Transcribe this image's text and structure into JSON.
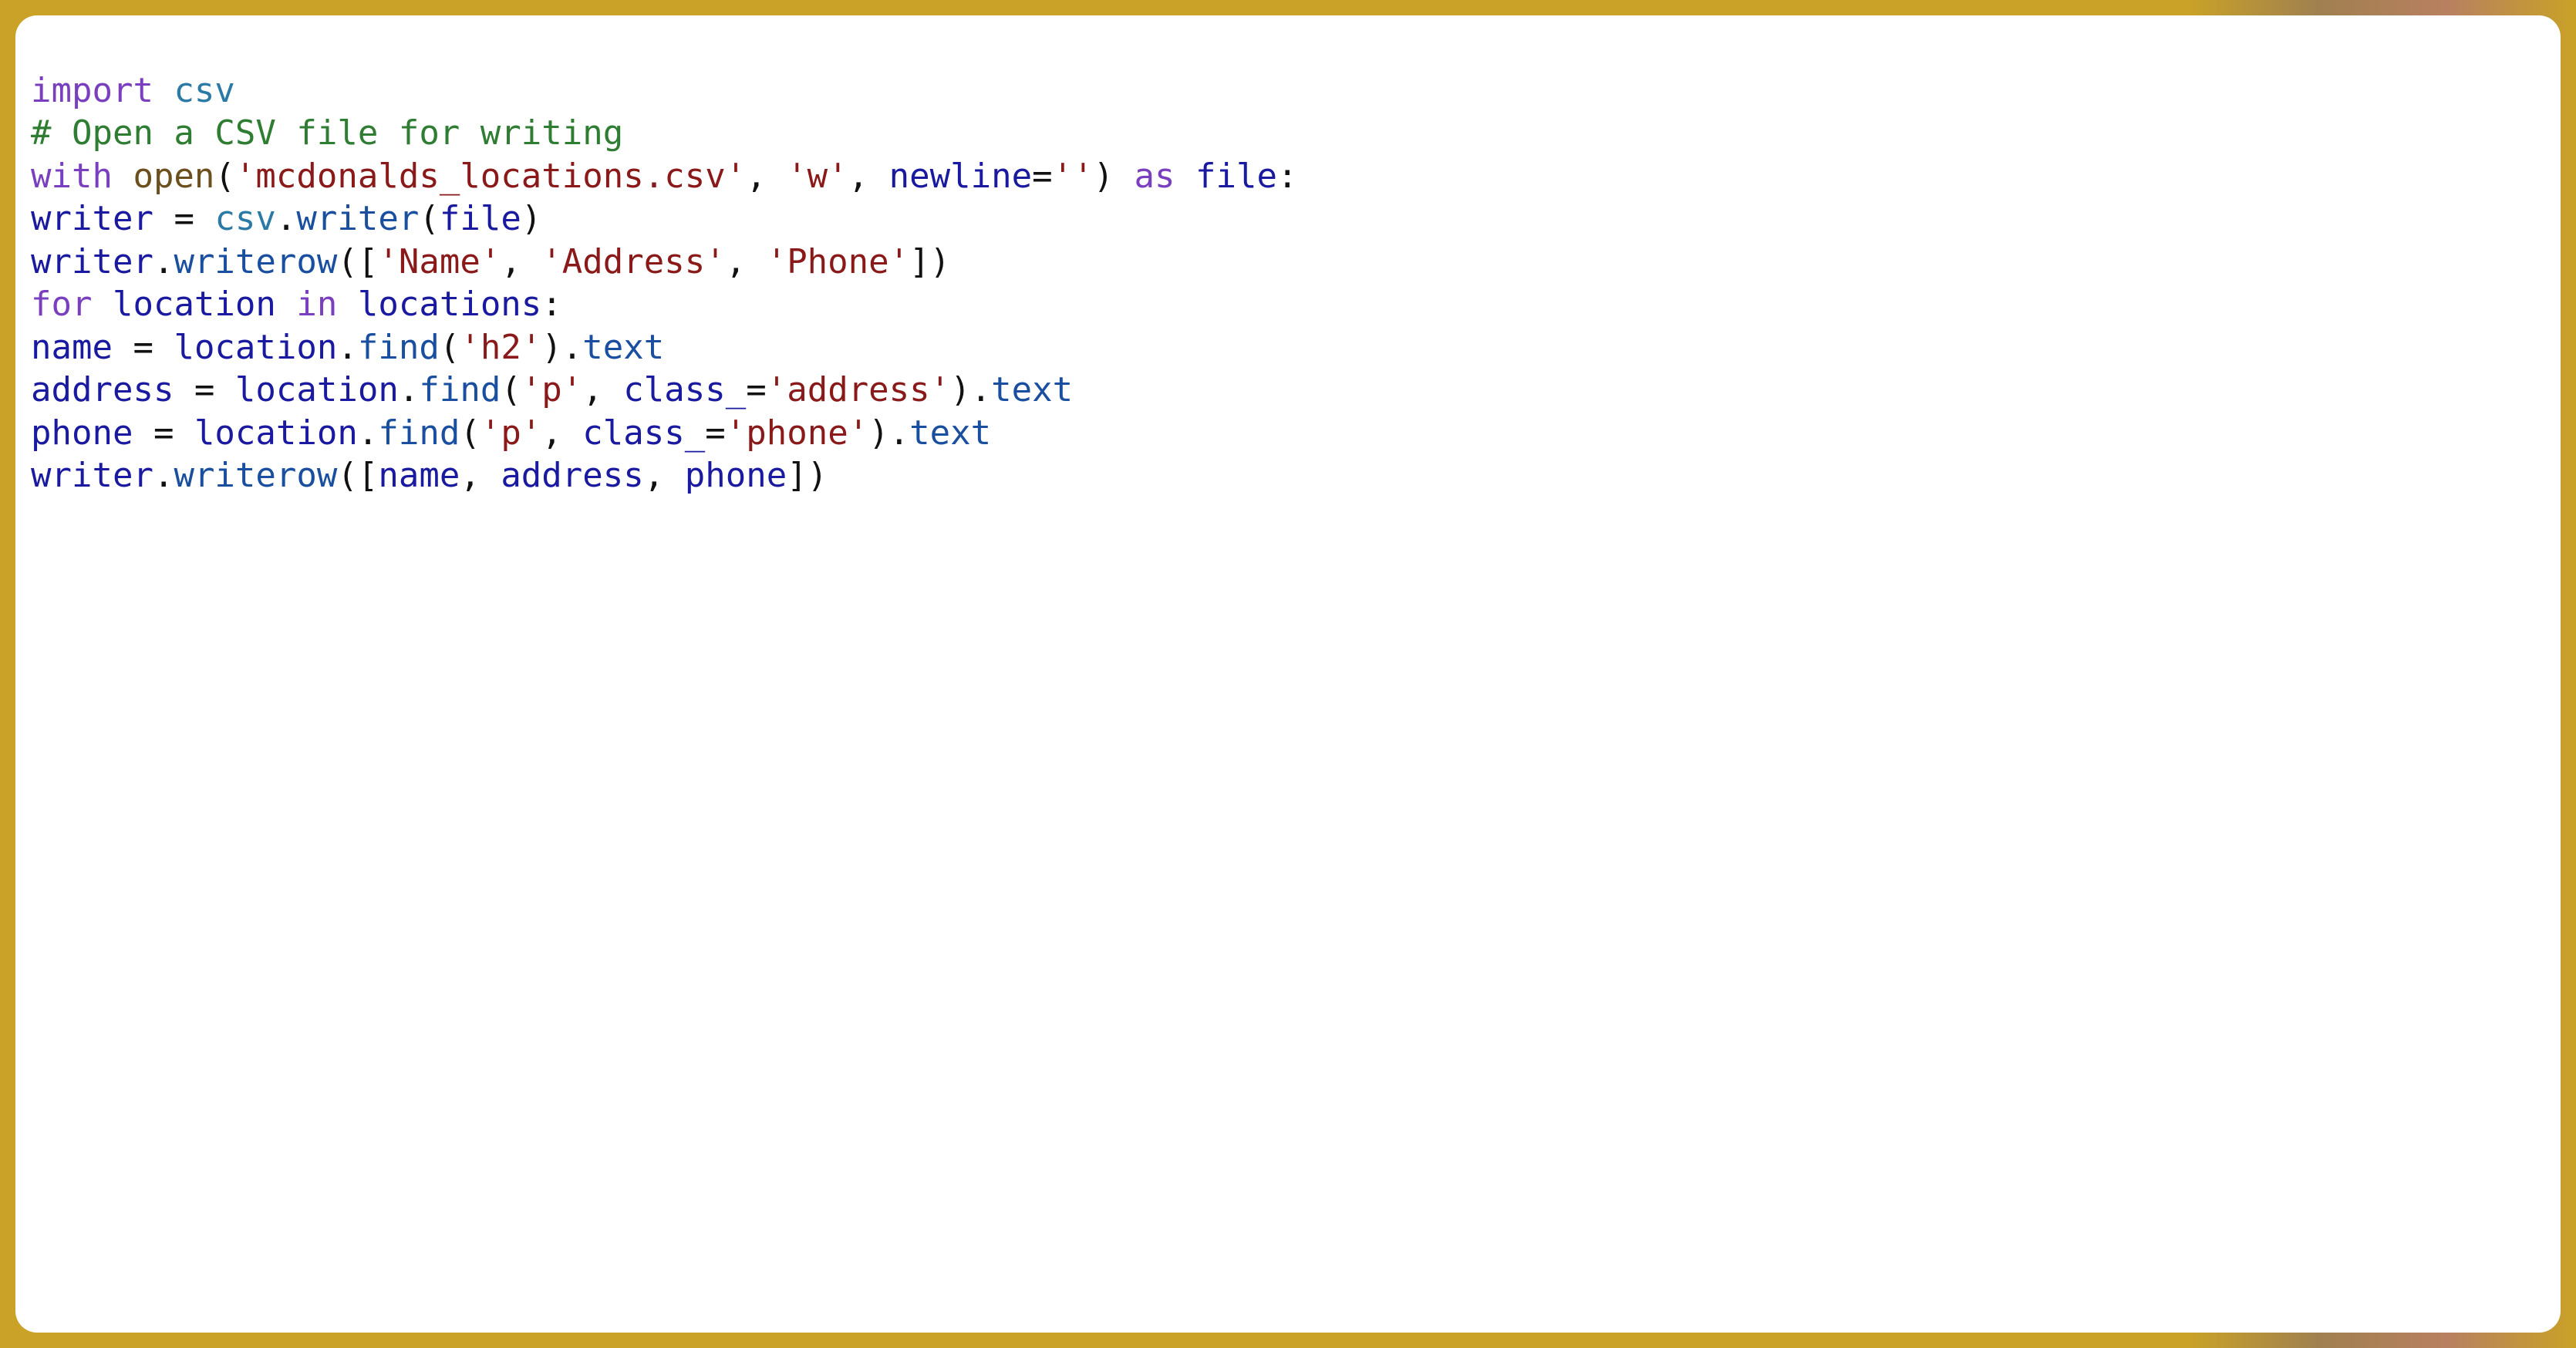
{
  "code": {
    "lines": [
      {
        "tokens": [
          {
            "t": "import ",
            "c": "tok-keyword"
          },
          {
            "t": "csv",
            "c": "tok-module"
          }
        ]
      },
      {
        "tokens": [
          {
            "t": "# Open a CSV file for writing",
            "c": "tok-comment"
          }
        ]
      },
      {
        "tokens": [
          {
            "t": "with ",
            "c": "tok-keyword"
          },
          {
            "t": "open",
            "c": "tok-builtin"
          },
          {
            "t": "(",
            "c": "tok-punct"
          },
          {
            "t": "'mcdonalds_locations.csv'",
            "c": "tok-string"
          },
          {
            "t": ", ",
            "c": "tok-punct"
          },
          {
            "t": "'w'",
            "c": "tok-string"
          },
          {
            "t": ", ",
            "c": "tok-punct"
          },
          {
            "t": "newline",
            "c": "tok-param"
          },
          {
            "t": "=",
            "c": "tok-punct"
          },
          {
            "t": "''",
            "c": "tok-string"
          },
          {
            "t": ") ",
            "c": "tok-punct"
          },
          {
            "t": "as ",
            "c": "tok-keyword"
          },
          {
            "t": "file",
            "c": "tok-name"
          },
          {
            "t": ":",
            "c": "tok-punct"
          }
        ]
      },
      {
        "tokens": [
          {
            "t": "writer",
            "c": "tok-name"
          },
          {
            "t": " = ",
            "c": "tok-punct"
          },
          {
            "t": "csv",
            "c": "tok-module"
          },
          {
            "t": ".",
            "c": "tok-punct"
          },
          {
            "t": "writer",
            "c": "tok-attr"
          },
          {
            "t": "(",
            "c": "tok-punct"
          },
          {
            "t": "file",
            "c": "tok-name"
          },
          {
            "t": ")",
            "c": "tok-punct"
          }
        ]
      },
      {
        "tokens": [
          {
            "t": "writer",
            "c": "tok-name"
          },
          {
            "t": ".",
            "c": "tok-punct"
          },
          {
            "t": "writerow",
            "c": "tok-attr"
          },
          {
            "t": "([",
            "c": "tok-punct"
          },
          {
            "t": "'Name'",
            "c": "tok-string"
          },
          {
            "t": ", ",
            "c": "tok-punct"
          },
          {
            "t": "'Address'",
            "c": "tok-string"
          },
          {
            "t": ", ",
            "c": "tok-punct"
          },
          {
            "t": "'Phone'",
            "c": "tok-string"
          },
          {
            "t": "])",
            "c": "tok-punct"
          }
        ]
      },
      {
        "tokens": [
          {
            "t": "for ",
            "c": "tok-keyword"
          },
          {
            "t": "location",
            "c": "tok-name"
          },
          {
            "t": " ",
            "c": "tok-punct"
          },
          {
            "t": "in ",
            "c": "tok-keyword"
          },
          {
            "t": "locations",
            "c": "tok-name"
          },
          {
            "t": ":",
            "c": "tok-punct"
          }
        ]
      },
      {
        "tokens": [
          {
            "t": "name",
            "c": "tok-name"
          },
          {
            "t": " = ",
            "c": "tok-punct"
          },
          {
            "t": "location",
            "c": "tok-name"
          },
          {
            "t": ".",
            "c": "tok-punct"
          },
          {
            "t": "find",
            "c": "tok-attr"
          },
          {
            "t": "(",
            "c": "tok-punct"
          },
          {
            "t": "'h2'",
            "c": "tok-string"
          },
          {
            "t": ").",
            "c": "tok-punct"
          },
          {
            "t": "text",
            "c": "tok-attr"
          }
        ]
      },
      {
        "tokens": [
          {
            "t": "address",
            "c": "tok-name"
          },
          {
            "t": " = ",
            "c": "tok-punct"
          },
          {
            "t": "location",
            "c": "tok-name"
          },
          {
            "t": ".",
            "c": "tok-punct"
          },
          {
            "t": "find",
            "c": "tok-attr"
          },
          {
            "t": "(",
            "c": "tok-punct"
          },
          {
            "t": "'p'",
            "c": "tok-string"
          },
          {
            "t": ", ",
            "c": "tok-punct"
          },
          {
            "t": "class_",
            "c": "tok-param"
          },
          {
            "t": "=",
            "c": "tok-punct"
          },
          {
            "t": "'address'",
            "c": "tok-string"
          },
          {
            "t": ").",
            "c": "tok-punct"
          },
          {
            "t": "text",
            "c": "tok-attr"
          }
        ]
      },
      {
        "tokens": [
          {
            "t": "phone",
            "c": "tok-name"
          },
          {
            "t": " = ",
            "c": "tok-punct"
          },
          {
            "t": "location",
            "c": "tok-name"
          },
          {
            "t": ".",
            "c": "tok-punct"
          },
          {
            "t": "find",
            "c": "tok-attr"
          },
          {
            "t": "(",
            "c": "tok-punct"
          },
          {
            "t": "'p'",
            "c": "tok-string"
          },
          {
            "t": ", ",
            "c": "tok-punct"
          },
          {
            "t": "class_",
            "c": "tok-param"
          },
          {
            "t": "=",
            "c": "tok-punct"
          },
          {
            "t": "'phone'",
            "c": "tok-string"
          },
          {
            "t": ").",
            "c": "tok-punct"
          },
          {
            "t": "text",
            "c": "tok-attr"
          }
        ]
      },
      {
        "tokens": [
          {
            "t": "writer",
            "c": "tok-name"
          },
          {
            "t": ".",
            "c": "tok-punct"
          },
          {
            "t": "writerow",
            "c": "tok-attr"
          },
          {
            "t": "([",
            "c": "tok-punct"
          },
          {
            "t": "name",
            "c": "tok-name"
          },
          {
            "t": ", ",
            "c": "tok-punct"
          },
          {
            "t": "address",
            "c": "tok-name"
          },
          {
            "t": ", ",
            "c": "tok-punct"
          },
          {
            "t": "phone",
            "c": "tok-name"
          },
          {
            "t": "])",
            "c": "tok-punct"
          }
        ]
      }
    ]
  }
}
